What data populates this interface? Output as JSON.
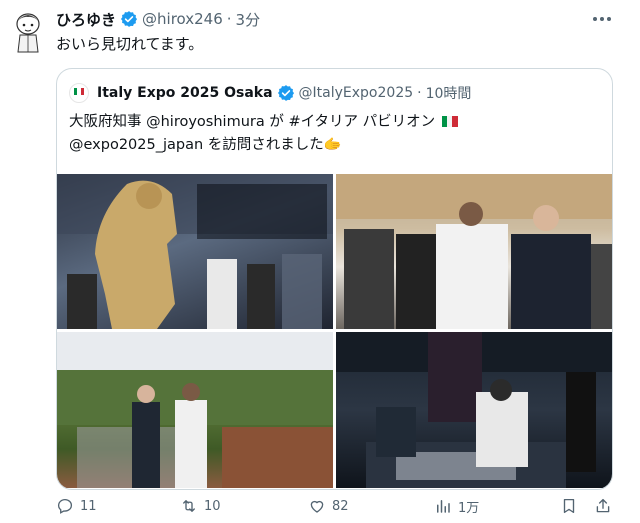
{
  "tweet": {
    "display_name": "ひろゆき",
    "handle": "@hirox246",
    "separator": "·",
    "time": "3分",
    "text": "おいら見切れてます。"
  },
  "quote": {
    "display_name": "Italy Expo 2025 Osaka",
    "handle": "@ItalyExpo2025",
    "separator": "·",
    "time": "10時間",
    "line1": "大阪府知事 @hiroyoshimura が #イタリア パビリオン",
    "line2": "@expo2025_japan を訪問されました🫱"
  },
  "actions": {
    "reply_count": "11",
    "retweet_count": "10",
    "like_count": "82",
    "views_count": "1万"
  },
  "colors": {
    "verified": "#1d9bf0",
    "text": "#0f1419",
    "muted": "#536471",
    "border": "#cfd9de",
    "italy_green": "#009246",
    "italy_red": "#ce2b37"
  },
  "icons": [
    "verified-badge-icon",
    "more-icon",
    "reply-icon",
    "retweet-icon",
    "like-icon",
    "views-icon",
    "bookmark-icon",
    "share-icon"
  ]
}
